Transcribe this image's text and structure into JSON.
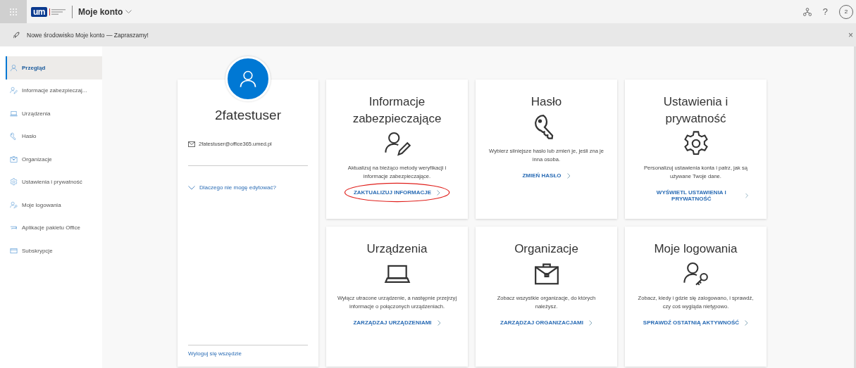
{
  "top_bar": {
    "app_title": "Moje konto",
    "logo": "um",
    "avatar_initial": "2",
    "help": "?"
  },
  "banner": {
    "text": "Nowe środowisko Moje konto — Zapraszamy!",
    "close": "×"
  },
  "sidebar": {
    "items": [
      {
        "label": "Przegląd",
        "kind": "overview",
        "selected": true
      },
      {
        "label": "Informacje zabezpieczaj...",
        "kind": "security",
        "selected": false
      },
      {
        "label": "Urządzenia",
        "kind": "devices",
        "selected": false
      },
      {
        "label": "Hasło",
        "kind": "password",
        "selected": false
      },
      {
        "label": "Organizacje",
        "kind": "organizations",
        "selected": false
      },
      {
        "label": "Ustawienia i prywatność",
        "kind": "settings",
        "selected": false
      },
      {
        "label": "Moje logowania",
        "kind": "signins",
        "selected": false
      },
      {
        "label": "Aplikacje pakietu Office",
        "kind": "apps",
        "selected": false
      },
      {
        "label": "Subskrypcje",
        "kind": "subscriptions",
        "selected": false
      }
    ]
  },
  "profile": {
    "name": "2fatestuser",
    "email": "2fatestuser@office365.umed.pl",
    "why_link": "Dlaczego nie mogę edytować?",
    "sign_out": "Wyloguj się wszędzie"
  },
  "cards": [
    {
      "title": "Informacje zabezpieczające",
      "kind": "security",
      "description": "Aktualizuj na bieżąco metody weryfikacji i informacje zabezpieczające.",
      "link": "ZAKTUALIZUJ INFORMACJE",
      "circled": true
    },
    {
      "title": "Hasło",
      "kind": "password",
      "description": "Wybierz silniejsze hasło lub zmień je, jeśli zna je inna osoba.",
      "link": "ZMIEŃ HASŁO",
      "circled": false
    },
    {
      "title": "Ustawienia i prywatność",
      "kind": "settings",
      "description": "Personalizuj ustawienia konta i patrz, jak są używane Twoje dane.",
      "link": "WYŚWIETL USTAWIENIA I PRYWATNOŚĆ",
      "circled": false
    },
    {
      "title": "Urządzenia",
      "kind": "devices",
      "description": "Wyłącz utracone urządzenie, a następnie przejrzyj informacje o połączonych urządzeniach.",
      "link": "ZARZĄDZAJ URZĄDZENIAMI",
      "circled": false
    },
    {
      "title": "Organizacje",
      "kind": "organizations",
      "description": "Zobacz wszystkie organizacje, do których należysz.",
      "link": "ZARZĄDZAJ ORGANIZACJAMI",
      "circled": false
    },
    {
      "title": "Moje logowania",
      "kind": "signins",
      "description": "Zobacz, kiedy i gdzie się zalogowano, i sprawdź, czy coś wygląda nietypowo.",
      "link": "SPRAWDŹ OSTATNIĄ AKTYWNOŚĆ",
      "circled": false
    }
  ]
}
